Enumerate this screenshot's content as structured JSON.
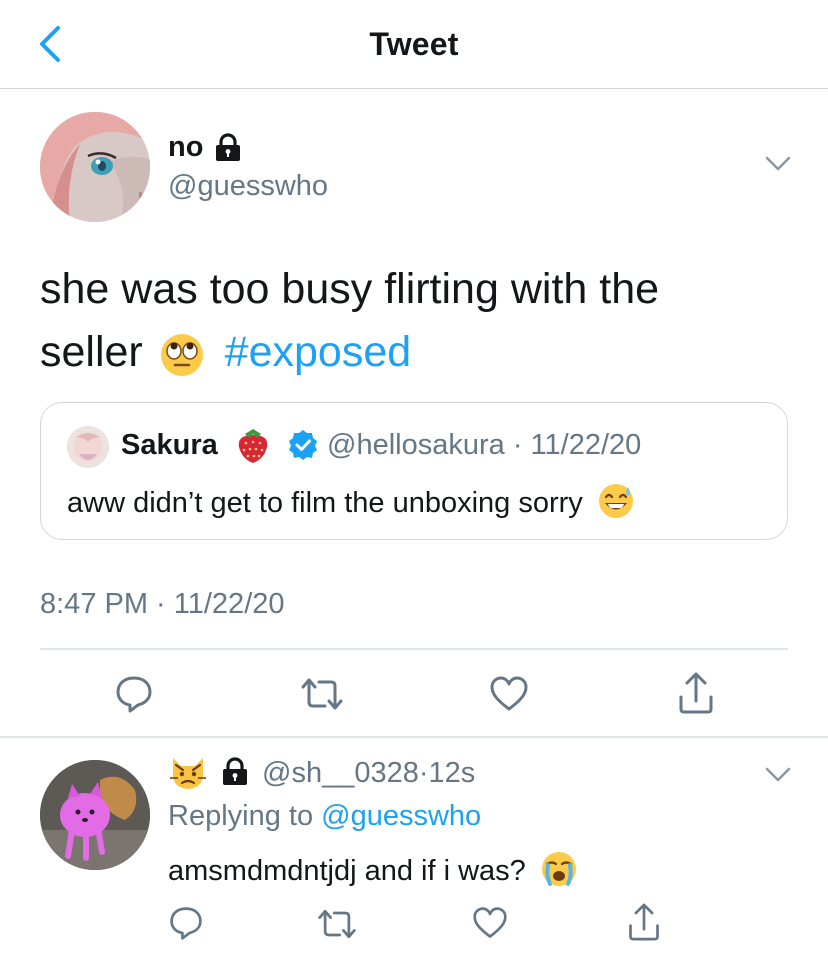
{
  "header": {
    "title": "Tweet"
  },
  "tweet": {
    "display_name": "no",
    "handle": "@guesswho",
    "text_main": "she was too busy flirting with the seller",
    "hashtag": "#exposed",
    "timestamp": "8:47 PM · 11/22/20",
    "quote": {
      "name": "Sakura",
      "handle": "@hellosakura",
      "date": "11/22/20",
      "text": "aww didn’t get to film the unboxing sorry"
    }
  },
  "reply": {
    "handle": "@sh__0328",
    "time": "12s",
    "replying_prefix": "Replying to",
    "replying_to": "@guesswho",
    "text": "amsmdmdntjdj and if i was?"
  },
  "icons": {
    "back": "chevron-left-icon",
    "lock": "lock-icon",
    "verified": "verified-badge-icon",
    "reply": "comment-icon",
    "retweet": "retweet-icon",
    "like": "heart-icon",
    "share": "share-icon"
  },
  "colors": {
    "accent": "#1da1f2",
    "secondary_text": "#657786",
    "divider": "#e1e6ea"
  }
}
